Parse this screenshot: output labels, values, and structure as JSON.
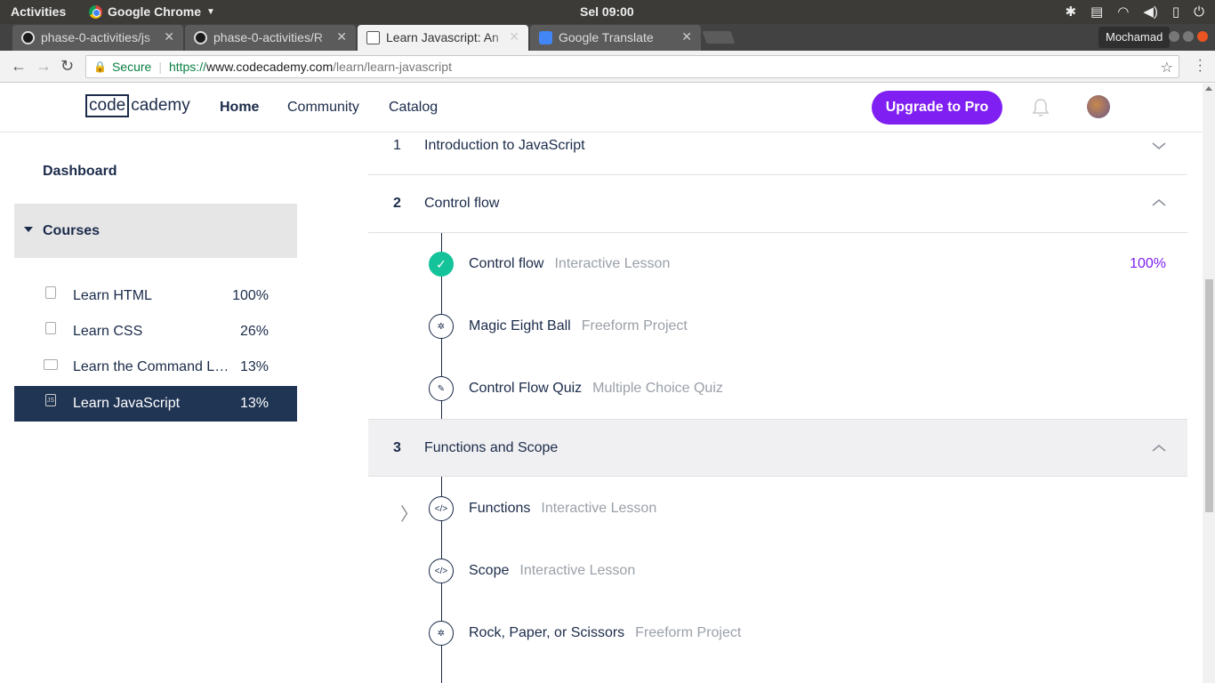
{
  "os_bar": {
    "activities": "Activities",
    "app_name": "Google Chrome",
    "clock": "Sel 09:00"
  },
  "browser": {
    "tabs": [
      {
        "label": "phase-0-activities/js",
        "icon": "github-icon"
      },
      {
        "label": "phase-0-activities/R",
        "icon": "github-icon"
      },
      {
        "label": "Learn Javascript: An",
        "icon": "codecademy-icon",
        "active": true
      },
      {
        "label": "Google Translate",
        "icon": "google-translate-icon"
      }
    ],
    "profile_name": "Mochamad",
    "address": {
      "secure_label": "Secure",
      "scheme": "https://",
      "domain": "www.codecademy.com",
      "path": "/learn/learn-javascript"
    }
  },
  "header": {
    "logo_boxed": "code",
    "logo_rest": "cademy",
    "nav": {
      "home": "Home",
      "community": "Community",
      "catalog": "Catalog"
    },
    "upgrade_label": "Upgrade to Pro"
  },
  "sidebar": {
    "dashboard": "Dashboard",
    "courses_label": "Courses",
    "courses": [
      {
        "label": "Learn HTML",
        "pct": "100%"
      },
      {
        "label": "Learn CSS",
        "pct": "26%"
      },
      {
        "label": "Learn the Command Line",
        "pct": "13%"
      },
      {
        "label": "Learn JavaScript",
        "pct": "13%",
        "active": true
      }
    ]
  },
  "syllabus": {
    "sections": [
      {
        "num": "1",
        "title": "Introduction to JavaScript",
        "expanded": false
      },
      {
        "num": "2",
        "title": "Control flow",
        "expanded": true
      },
      {
        "num": "3",
        "title": "Functions and Scope",
        "expanded": true
      }
    ],
    "section2_lessons": [
      {
        "name": "Control flow",
        "type": "Interactive Lesson",
        "pct": "100%",
        "icon": "check-icon"
      },
      {
        "name": "Magic Eight Ball",
        "type": "Freeform Project",
        "icon": "puzzle-icon"
      },
      {
        "name": "Control Flow Quiz",
        "type": "Multiple Choice Quiz",
        "icon": "quiz-icon"
      }
    ],
    "section3_lessons": [
      {
        "name": "Functions",
        "type": "Interactive Lesson",
        "icon": "code-icon"
      },
      {
        "name": "Scope",
        "type": "Interactive Lesson",
        "icon": "code-icon"
      },
      {
        "name": "Rock, Paper, or Scissors",
        "type": "Freeform Project",
        "icon": "puzzle-icon"
      }
    ]
  },
  "colors": {
    "brand_purple": "#7f1ff2",
    "navy": "#1b2b4a",
    "complete_green": "#15c39a",
    "active_course_bg": "#203554"
  }
}
